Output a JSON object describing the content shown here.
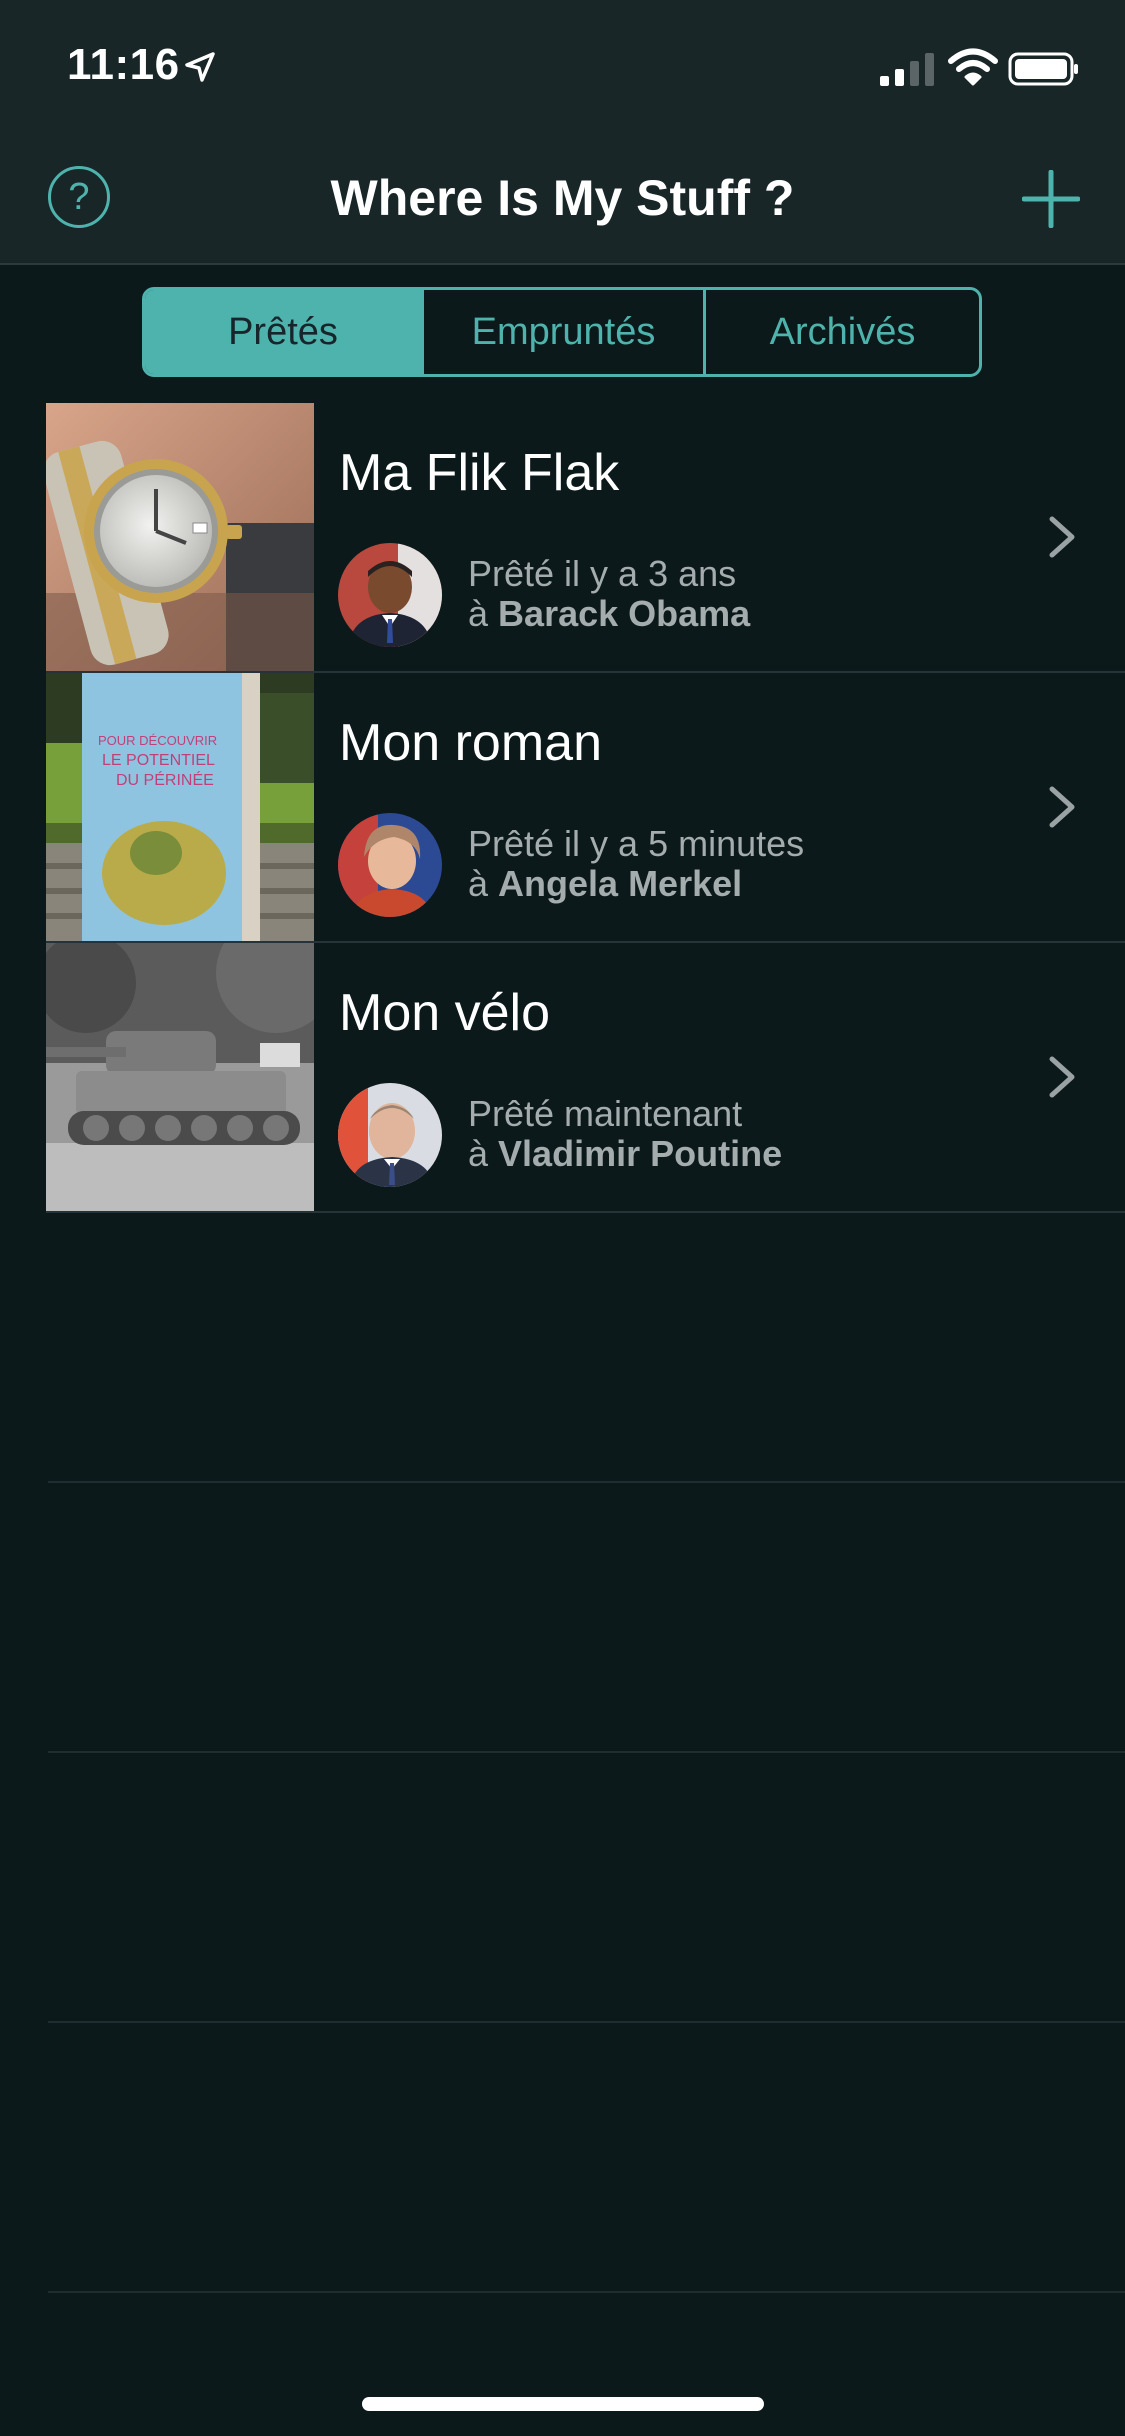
{
  "status_bar": {
    "time": "11:16",
    "location_icon": "location-arrow-icon",
    "signal_icon": "cellular-signal-icon",
    "wifi_icon": "wifi-icon",
    "battery_icon": "battery-icon"
  },
  "nav": {
    "help_label": "?",
    "title": "Where Is My Stuff ?",
    "add_icon": "plus-icon"
  },
  "tabs": [
    {
      "label": "Prêtés",
      "selected": true
    },
    {
      "label": "Empruntés",
      "selected": false
    },
    {
      "label": "Archivés",
      "selected": false
    }
  ],
  "items": [
    {
      "title": "Ma Flik Flak",
      "status": "Prêté il y a 3 ans",
      "prefix": "à",
      "person": "Barack Obama",
      "thumbnail": "watch-photo",
      "avatar": "barack-obama-avatar"
    },
    {
      "title": "Mon roman",
      "status": "Prêté il y a 5 minutes",
      "prefix": "à",
      "person": "Angela Merkel",
      "thumbnail": "book-photo",
      "avatar": "angela-merkel-avatar"
    },
    {
      "title": "Mon vélo",
      "status": "Prêté maintenant",
      "prefix": "à",
      "person": "Vladimir Poutine",
      "thumbnail": "tank-photo",
      "avatar": "vladimir-poutine-avatar"
    }
  ],
  "colors": {
    "accent": "#4fb3ad",
    "background": "#0b191a",
    "header": "#192628",
    "text_secondary": "#a4acae"
  }
}
